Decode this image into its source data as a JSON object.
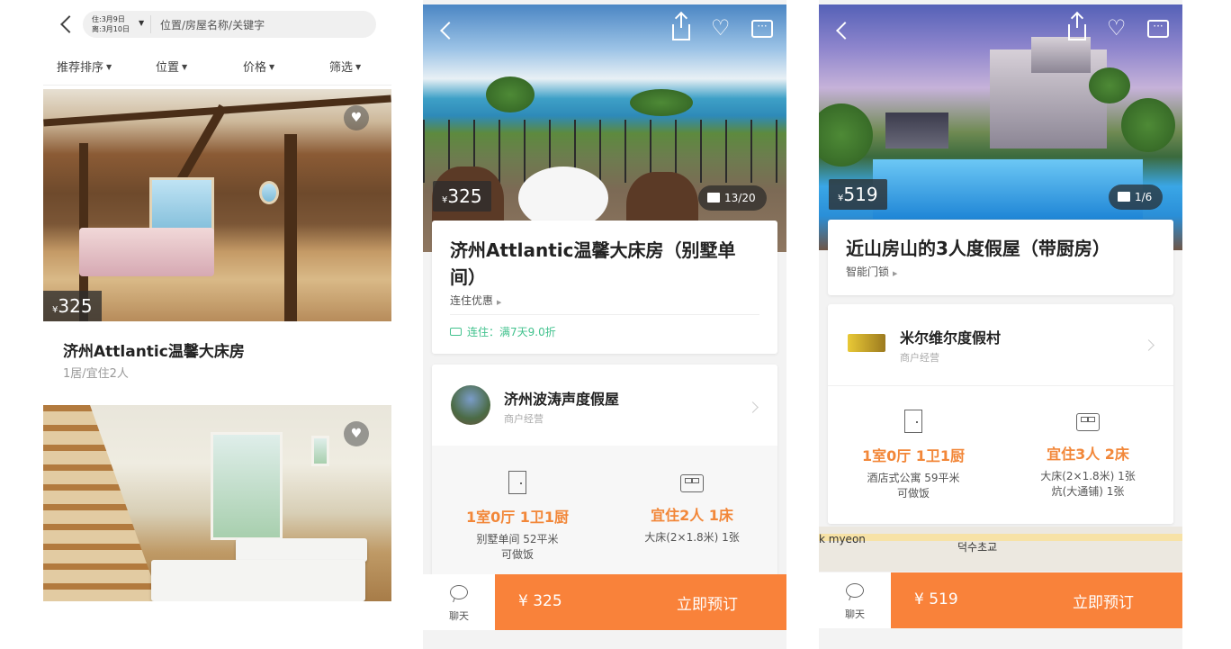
{
  "screen1": {
    "dates": {
      "checkin": "住:3月9日",
      "checkout": "离:3月10日"
    },
    "search_placeholder": "位置/房屋名称/关键字",
    "filters": [
      "推荐排序",
      "位置",
      "价格",
      "筛选"
    ],
    "listings": [
      {
        "price_currency": "¥",
        "price": "325",
        "title": "济州Attlantic温馨大床房",
        "subtitle": "1居/宜住2人"
      },
      {
        "price_currency": "¥",
        "price": "",
        "title": "",
        "subtitle": ""
      }
    ],
    "icons": {
      "back": "chevron-left-icon",
      "favorite": "heart-icon",
      "dropdown": "caret-down-icon"
    }
  },
  "screen2": {
    "photo_counter": "13/20",
    "price_currency": "¥",
    "price": "325",
    "title": "济州Attlantic温馨大床房（别墅单间）",
    "tag": "连住优惠",
    "promo": "连住：满7天9.0折",
    "host": {
      "name": "济州波涛声度假屋",
      "type": "商户经营"
    },
    "features": [
      {
        "main": "1室0厅 1卫1厨",
        "sub1": "别墅单间 52平米",
        "sub2": "可做饭"
      },
      {
        "main": "宜住2人 1床",
        "sub1": "大床(2×1.8米) 1张",
        "sub2": ""
      }
    ],
    "bottom": {
      "chat": "聊天",
      "price": "¥ 325",
      "book": "立即预订"
    }
  },
  "screen3": {
    "photo_counter": "1/6",
    "price_currency": "¥",
    "price": "519",
    "title": "近山房山的3人度假屋（带厨房）",
    "tag": "智能门锁",
    "host": {
      "name": "米尔维尔度假村",
      "type": "商户经营"
    },
    "features": [
      {
        "main": "1室0厅 1卫1厨",
        "sub1": "酒店式公寓 59平米",
        "sub2": "可做饭"
      },
      {
        "main": "宜住3人 2床",
        "sub1": "大床(2×1.8米) 1张",
        "sub2": "炕(大通铺) 1张"
      }
    ],
    "map_labels": [
      "k myeon",
      "덕수초교"
    ],
    "bottom": {
      "chat": "聊天",
      "price": "¥ 519",
      "book": "立即预订"
    }
  },
  "colors": {
    "accent": "#f9823a",
    "feature_text": "#f28739",
    "promo_green": "#42c28e"
  }
}
